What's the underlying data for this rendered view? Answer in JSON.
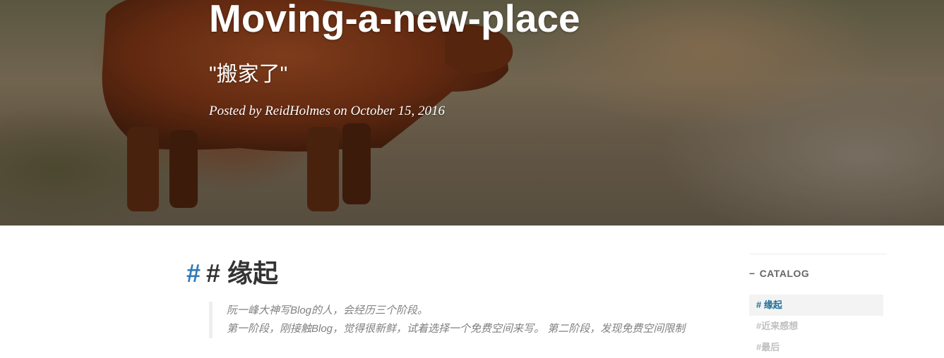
{
  "hero": {
    "title": "Moving-a-new-place",
    "subtitle": "\"搬家了\"",
    "meta": "Posted by ReidHolmes on October 15, 2016"
  },
  "article": {
    "anchor_symbol": "#",
    "heading": "# 缘起",
    "quote_lines": [
      "阮一峰大神写Blog的人，会经历三个阶段。",
      "第一阶段，刚接触Blog，觉得很新鲜，试着选择一个免费空间来写。 第二阶段，发现免费空间限制"
    ]
  },
  "catalog": {
    "dash": "−",
    "title": "CATALOG",
    "items": [
      {
        "label": "# 缘起",
        "active": true
      },
      {
        "label": "#近来感想",
        "active": false
      },
      {
        "label": "#最后",
        "active": false
      }
    ]
  },
  "colors": {
    "link_blue": "#337ab7",
    "catalog_active": "#1f6f99",
    "heading": "#333333"
  }
}
